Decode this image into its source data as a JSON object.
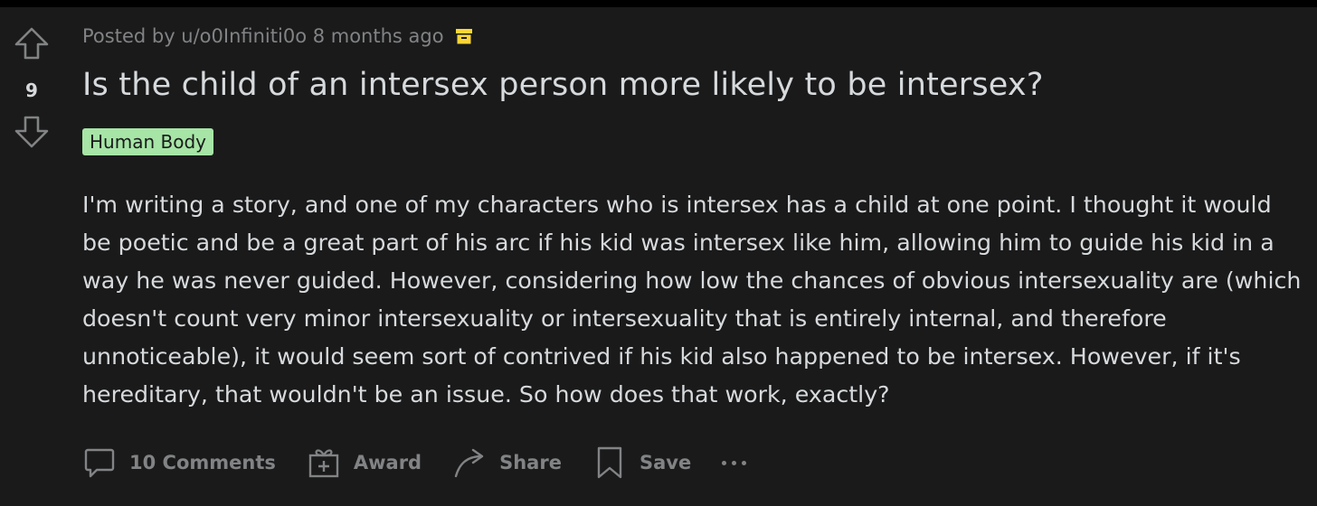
{
  "post": {
    "score": "9",
    "meta": "Posted by u/o0Infiniti0o 8 months ago",
    "title": "Is the child of an intersex person more likely to be intersex?",
    "flair": "Human Body",
    "body": "I'm writing a story, and one of my characters who is intersex has a child at one point. I thought it would be poetic and be a great part of his arc if his kid was intersex like him, allowing him to guide his kid in a way he was never guided. However, considering how low the chances of obvious intersexuality are (which doesn't count very minor intersexuality or intersexuality that is entirely internal, and therefore unnoticeable), it would seem sort of contrived if his kid also happened to be intersex. However, if it's hereditary, that wouldn't be an issue. So how does that work, exactly?"
  },
  "actions": {
    "comments_label": "10 Comments",
    "award_label": "Award",
    "share_label": "Share",
    "save_label": "Save"
  },
  "icons": {
    "upvote": "arrow-up-outline-icon",
    "downvote": "arrow-down-outline-icon",
    "archive": "archive-box-icon",
    "comments": "speech-bubble-icon",
    "award": "gift-box-icon",
    "share": "curved-arrow-icon",
    "save": "bookmark-icon",
    "more": "ellipsis-icon"
  },
  "colors": {
    "background": "#1a1a1b",
    "text": "#d7dadc",
    "muted": "#818384",
    "flair_bg": "#a6e5a6",
    "archive_icon": "#ffd635"
  }
}
